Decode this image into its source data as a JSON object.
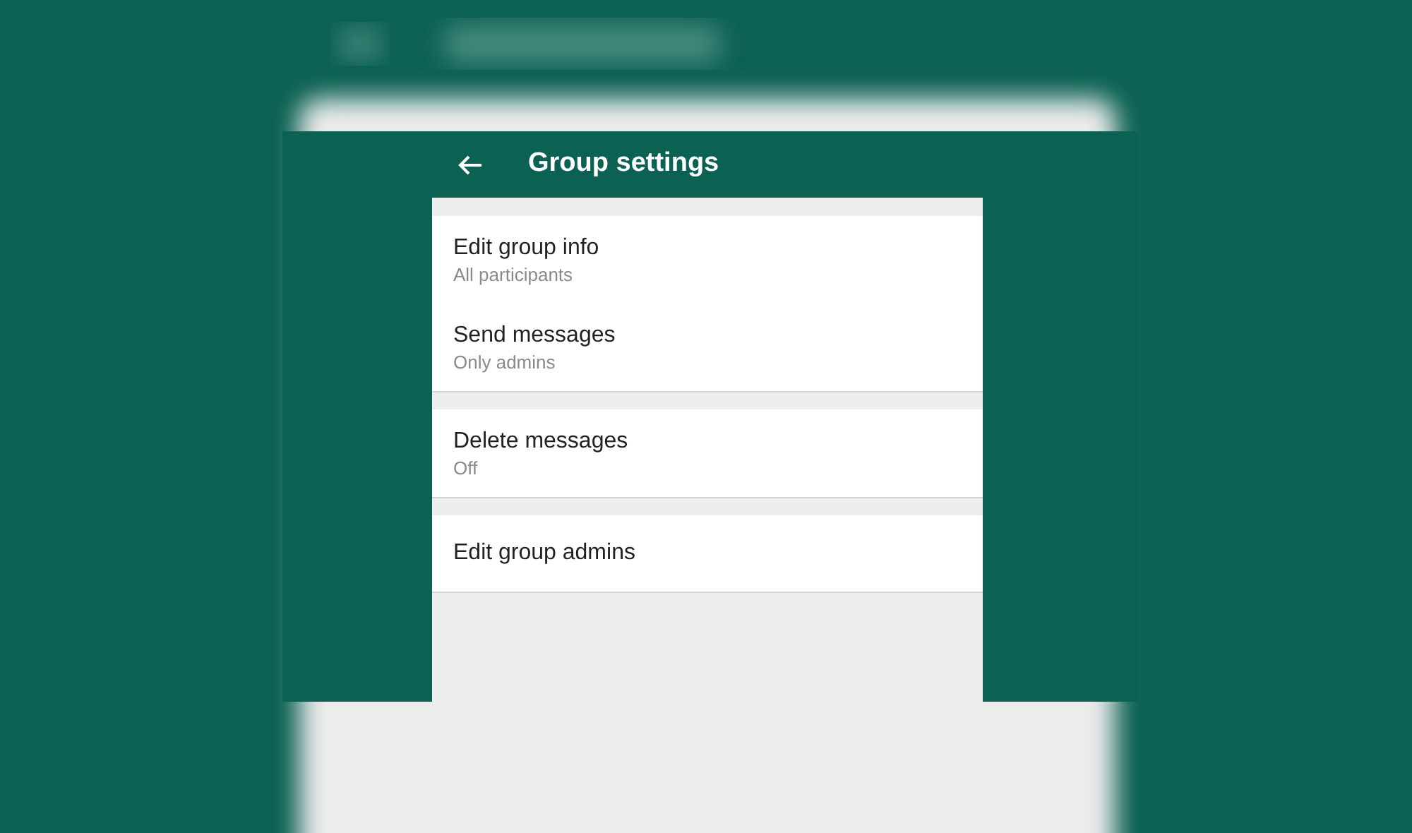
{
  "app_bar": {
    "title": "Group settings"
  },
  "sections": [
    {
      "items": [
        {
          "title": "Edit group info",
          "subtitle": "All participants"
        },
        {
          "title": "Send messages",
          "subtitle": "Only admins"
        }
      ]
    },
    {
      "items": [
        {
          "title": "Delete messages",
          "subtitle": "Off"
        }
      ]
    },
    {
      "items": [
        {
          "title": "Edit group admins"
        }
      ]
    }
  ]
}
